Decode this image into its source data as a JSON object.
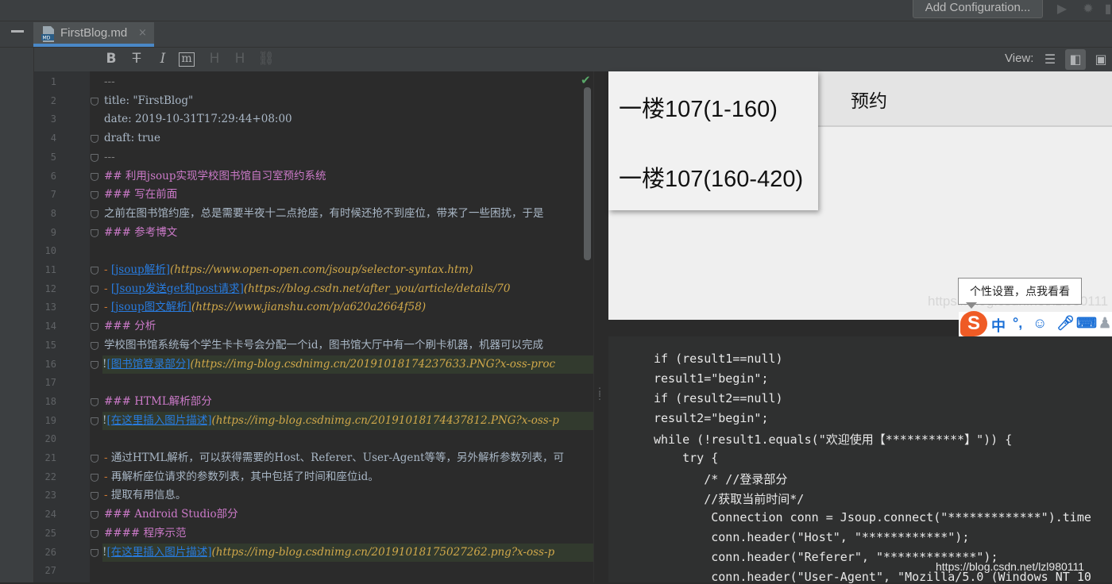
{
  "toolbar": {
    "add_configuration": "Add Configuration...",
    "run_icon": "play-icon",
    "debug_icon": "bug-icon"
  },
  "tab": {
    "icon": "markdown-file-icon",
    "title": "FirstBlog.md",
    "close": "×"
  },
  "format_bar": {
    "bold": "B",
    "strikethrough": "T",
    "italic": "I",
    "code": "m",
    "header_down": "H",
    "header_up": "H",
    "link_icon": "link-icon",
    "view_label": "View:"
  },
  "editor": {
    "line_numbers": [
      "1",
      "2",
      "3",
      "4",
      "5",
      "6",
      "7",
      "8",
      "9",
      "10",
      "11",
      "12",
      "13",
      "14",
      "15",
      "16",
      "17",
      "18",
      "19",
      "20",
      "21",
      "22",
      "23",
      "24",
      "25",
      "26",
      "27"
    ],
    "lines": [
      [
        {
          "t": "---",
          "c": "c-mute"
        }
      ],
      [
        {
          "t": "title: \"FirstBlog\"",
          "c": "c-plain"
        }
      ],
      [
        {
          "t": "date: 2019-10-31T17:29:44+08:00",
          "c": "c-plain"
        }
      ],
      [
        {
          "t": "draft: true",
          "c": "c-plain"
        }
      ],
      [
        {
          "t": "---",
          "c": "c-mute"
        }
      ],
      [
        {
          "t": "## 利用jsoup实现学校图书馆自习室预约系统",
          "c": "c-head"
        }
      ],
      [
        {
          "t": "### 写在前面",
          "c": "c-head"
        }
      ],
      [
        {
          "t": "之前在图书馆约座，总是需要半夜十二点抢座，有时候还抢不到座位，带来了一些困扰，于是",
          "c": "c-plain"
        }
      ],
      [
        {
          "t": "### 参考博文",
          "c": "c-head"
        }
      ],
      [],
      [
        {
          "t": " - ",
          "c": "c-dash"
        },
        {
          "t": "[jsoup解析]",
          "c": "c-link"
        },
        {
          "t": "(https://www.open-open.com/jsoup/selector-syntax.htm)",
          "c": "c-url"
        }
      ],
      [
        {
          "t": " - ",
          "c": "c-dash"
        },
        {
          "t": "[Jsoup发送get和post请求]",
          "c": "c-link"
        },
        {
          "t": "(https://blog.csdn.net/after_you/article/details/70",
          "c": "c-url"
        }
      ],
      [
        {
          "t": " - ",
          "c": "c-dash"
        },
        {
          "t": "[jsoup图文解析]",
          "c": "c-link"
        },
        {
          "t": "(https://www.jianshu.com/p/a620a2664f58)",
          "c": "c-url"
        }
      ],
      [
        {
          "t": "### 分析",
          "c": "c-head"
        }
      ],
      [
        {
          "t": "学校图书馆系统每个学生卡卡号会分配一个id，图书馆大厅中有一个刷卡机器，机器可以完成",
          "c": "c-plain"
        }
      ],
      [
        {
          "t": "!",
          "c": "c-plain"
        },
        {
          "t": "[图书馆登录部分]",
          "c": "c-link"
        },
        {
          "t": "(https://img-blog.csdnimg.cn/20191018174237633.PNG?x-oss-proc",
          "c": "c-url"
        }
      ],
      [],
      [
        {
          "t": "### HTML解析部分",
          "c": "c-head"
        }
      ],
      [
        {
          "t": "!",
          "c": "c-plain"
        },
        {
          "t": "[在这里插入图片描述]",
          "c": "c-link"
        },
        {
          "t": "(https://img-blog.csdnimg.cn/20191018174437812.PNG?x-oss-p",
          "c": "c-url"
        }
      ],
      [],
      [
        {
          "t": " - ",
          "c": "c-dash"
        },
        {
          "t": "通过HTML解析，可以获得需要的Host、Referer、User-Agent等等，另外解析参数列表，可",
          "c": "c-plain"
        }
      ],
      [
        {
          "t": " - ",
          "c": "c-dash"
        },
        {
          "t": "再解析座位请求的参数列表，其中包括了时间和座位id。",
          "c": "c-plain"
        }
      ],
      [
        {
          "t": " - ",
          "c": "c-dash"
        },
        {
          "t": "提取有用信息。",
          "c": "c-plain"
        }
      ],
      [
        {
          "t": "### Android Studio部分",
          "c": "c-head"
        }
      ],
      [
        {
          "t": "#### 程序示范",
          "c": "c-head"
        }
      ],
      [
        {
          "t": "!",
          "c": "c-plain"
        },
        {
          "t": "[在这里插入图片描述]",
          "c": "c-link"
        },
        {
          "t": "(https://img-blog.csdnimg.cn/20191018175027262.png?x-oss-p",
          "c": "c-url"
        }
      ],
      []
    ]
  },
  "preview": {
    "item1": "一楼107(1-160)",
    "item2": "一楼107(160-420)",
    "header": "预约",
    "watermark_top": "https://blog.csdn.net/lzl980111",
    "tooltip": "个性设置，点我看看",
    "ime": {
      "logo": "S",
      "zh": "中",
      "punct": "°,",
      "emoji_icon": "smiley-icon",
      "mic_icon": "microphone-icon",
      "keyboard_icon": "keyboard-icon",
      "user_icon": "user-icon"
    },
    "code_lines": [
      "if (result1==null)",
      "result1=\"begin\";",
      "if (result2==null)",
      "result2=\"begin\";",
      "while (!result1.equals(\"欢迎使用【***********】\")) {",
      "    try {",
      "       /* //登录部分",
      "       //获取当前时间*/",
      "        Connection conn = Jsoup.connect(\"*************\").time",
      "        conn.header(\"Host\", \"************\");",
      "        conn.header(\"Referer\", \"*************\");",
      "        conn.header(\"User-Agent\", \"Mozilla/5.0 (Windows NT 10"
    ],
    "watermark_bottom": "https://blog.csdn.net/lzl980111"
  },
  "colors": {
    "accent": "#4a88c7",
    "background": "#2b2b2b",
    "panel": "#3c3f41",
    "heading": "#cc7ac9",
    "link": "#287bde",
    "url": "#d0a84a"
  }
}
